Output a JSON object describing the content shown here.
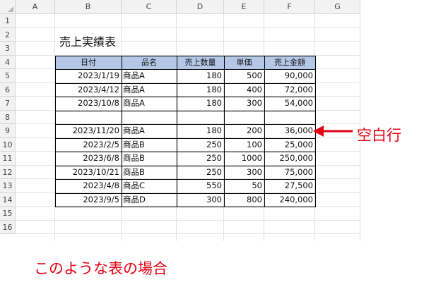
{
  "spreadsheet": {
    "columns": [
      "A",
      "B",
      "C",
      "D",
      "E",
      "F",
      "G"
    ],
    "rows": [
      "1",
      "2",
      "3",
      "4",
      "5",
      "6",
      "7",
      "8",
      "9",
      "10",
      "11",
      "12",
      "13",
      "14",
      "15",
      "16"
    ],
    "title": "売上実績表",
    "table": {
      "headers": [
        "日付",
        "品名",
        "売上数量",
        "単価",
        "売上金額"
      ],
      "rows": [
        [
          "2023/1/19",
          "商品A",
          "180",
          "500",
          "90,000"
        ],
        [
          "2023/4/12",
          "商品A",
          "180",
          "400",
          "72,000"
        ],
        [
          "2023/10/8",
          "商品A",
          "180",
          "300",
          "54,000"
        ],
        [
          "",
          "",
          "",
          "",
          ""
        ],
        [
          "2023/11/20",
          "商品A",
          "180",
          "200",
          "36,000"
        ],
        [
          "2023/2/5",
          "商品B",
          "250",
          "100",
          "25,000"
        ],
        [
          "2023/6/8",
          "商品B",
          "250",
          "1000",
          "250,000"
        ],
        [
          "2023/10/21",
          "商品B",
          "250",
          "300",
          "75,000"
        ],
        [
          "2023/4/8",
          "商品C",
          "550",
          "50",
          "27,500"
        ],
        [
          "2023/9/5",
          "商品D",
          "300",
          "800",
          "240,000"
        ]
      ]
    }
  },
  "annotation": {
    "blank_row_label": "空白行",
    "color": "#e60012"
  },
  "caption": "このような表の場合",
  "colors": {
    "header_fill": "#b4c7e7",
    "grid": "#e2e2e2",
    "header_bar": "#f2f2f2"
  }
}
